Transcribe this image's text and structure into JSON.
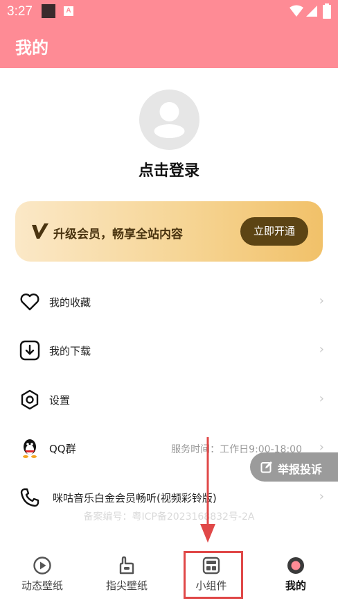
{
  "status_bar": {
    "time": "3:27",
    "notification_letter": "A"
  },
  "app": {
    "title": "我的"
  },
  "profile": {
    "login_text": "点击登录"
  },
  "vip": {
    "promo_text": "升级会员，畅享全站内容",
    "cta_label": "立即开通"
  },
  "menu": {
    "favorites": "我的收藏",
    "downloads": "我的下载",
    "settings": "设置",
    "qq_group": "QQ群",
    "service_hours": "服务时间：工作日9:00-18:00",
    "ringtone": "咪咕音乐白金会员畅听(视频彩铃版)"
  },
  "footer": {
    "icp": "备案编号：粤ICP备2023168832号-2A"
  },
  "report": {
    "label": "举报投诉"
  },
  "tabs": {
    "live_wallpaper": "动态壁纸",
    "fingertip_wallpaper": "指尖壁纸",
    "widgets": "小组件",
    "mine": "我的"
  },
  "colors": {
    "header": "#fe8b95",
    "vip_button": "#5c4414",
    "highlight": "#e04848"
  }
}
